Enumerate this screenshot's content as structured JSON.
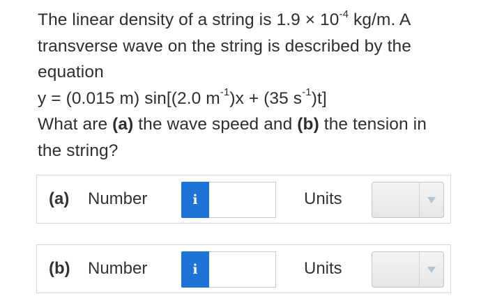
{
  "question": {
    "line1_pre": "The linear density of a string is 1.9 × 10",
    "line1_exp": "-4",
    "line1_post": " kg/m. A",
    "line2": "transverse wave on the string is described by the",
    "line3": "equation",
    "eq_pre": "y = (0.015 m) sin[(2.0 m",
    "eq_exp1": "-1",
    "eq_mid": ")x + (35 s",
    "eq_exp2": "-1",
    "eq_post": ")t]",
    "line5_pre": "What are ",
    "part_a_tag": "(a)",
    "line5_mid": " the wave speed and ",
    "part_b_tag": "(b)",
    "line5_post": " the tension in",
    "line6": "the string?"
  },
  "answers": [
    {
      "part_label": "(a)",
      "number_label": "Number",
      "info_icon": "info-icon",
      "info_glyph": "i",
      "number_value": "",
      "units_label": "Units",
      "units_value": ""
    },
    {
      "part_label": "(b)",
      "number_label": "Number",
      "info_icon": "info-icon",
      "info_glyph": "i",
      "number_value": "",
      "units_label": "Units",
      "units_value": ""
    }
  ],
  "colors": {
    "info_button": "#1d73d6",
    "text": "#2f2f2f",
    "border": "#d8d8d8"
  }
}
